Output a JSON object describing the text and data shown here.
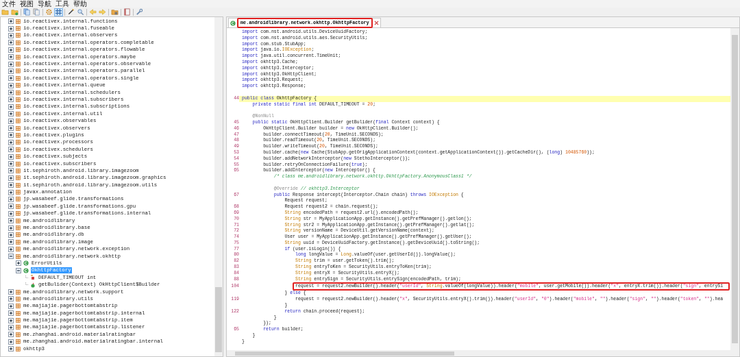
{
  "menu": [
    "文件",
    "视图",
    "导航",
    "工具",
    "帮助"
  ],
  "toolbar": [
    {
      "kind": "open",
      "pressed": false
    },
    {
      "kind": "add",
      "pressed": false
    },
    {
      "kind": "separator"
    },
    {
      "kind": "copy",
      "pressed": false
    },
    {
      "kind": "copy-gray",
      "pressed": false
    },
    {
      "kind": "separator"
    },
    {
      "kind": "gear",
      "pressed": false
    },
    {
      "kind": "grid",
      "pressed": true
    },
    {
      "kind": "separator"
    },
    {
      "kind": "pen",
      "pressed": false
    },
    {
      "kind": "search",
      "pressed": false
    },
    {
      "kind": "separator"
    },
    {
      "kind": "back",
      "pressed": false
    },
    {
      "kind": "forward",
      "pressed": false
    },
    {
      "kind": "separator"
    },
    {
      "kind": "lock",
      "pressed": false
    },
    {
      "kind": "separator"
    },
    {
      "kind": "book",
      "pressed": false
    },
    {
      "kind": "separator"
    },
    {
      "kind": "wrench",
      "pressed": false
    }
  ],
  "tree": {
    "items": [
      {
        "label": "io.reactivex.internal.functions",
        "kind": "package",
        "expanded": false,
        "selected": false
      },
      {
        "label": "io.reactivex.internal.fuseable",
        "kind": "package",
        "expanded": false,
        "selected": false
      },
      {
        "label": "io.reactivex.internal.observers",
        "kind": "package",
        "expanded": false,
        "selected": false
      },
      {
        "label": "io.reactivex.internal.operators.completable",
        "kind": "package",
        "expanded": false,
        "selected": false
      },
      {
        "label": "io.reactivex.internal.operators.flowable",
        "kind": "package",
        "expanded": false,
        "selected": false
      },
      {
        "label": "io.reactivex.internal.operators.maybe",
        "kind": "package",
        "expanded": false,
        "selected": false
      },
      {
        "label": "io.reactivex.internal.operators.observable",
        "kind": "package",
        "expanded": false,
        "selected": false
      },
      {
        "label": "io.reactivex.internal.operators.parallel",
        "kind": "package",
        "expanded": false,
        "selected": false
      },
      {
        "label": "io.reactivex.internal.operators.single",
        "kind": "package",
        "expanded": false,
        "selected": false
      },
      {
        "label": "io.reactivex.internal.queue",
        "kind": "package",
        "expanded": false,
        "selected": false
      },
      {
        "label": "io.reactivex.internal.schedulers",
        "kind": "package",
        "expanded": false,
        "selected": false
      },
      {
        "label": "io.reactivex.internal.subscribers",
        "kind": "package",
        "expanded": false,
        "selected": false
      },
      {
        "label": "io.reactivex.internal.subscriptions",
        "kind": "package",
        "expanded": false,
        "selected": false
      },
      {
        "label": "io.reactivex.internal.util",
        "kind": "package",
        "expanded": false,
        "selected": false
      },
      {
        "label": "io.reactivex.observables",
        "kind": "package",
        "expanded": false,
        "selected": false
      },
      {
        "label": "io.reactivex.observers",
        "kind": "package",
        "expanded": false,
        "selected": false
      },
      {
        "label": "io.reactivex.plugins",
        "kind": "package",
        "expanded": false,
        "selected": false
      },
      {
        "label": "io.reactivex.processors",
        "kind": "package",
        "expanded": false,
        "selected": false
      },
      {
        "label": "io.reactivex.schedulers",
        "kind": "package",
        "expanded": false,
        "selected": false
      },
      {
        "label": "io.reactivex.subjects",
        "kind": "package",
        "expanded": false,
        "selected": false
      },
      {
        "label": "io.reactivex.subscribers",
        "kind": "package",
        "expanded": false,
        "selected": false
      },
      {
        "label": "it.sephiroth.android.library.imagezoom",
        "kind": "package",
        "expanded": false,
        "selected": false
      },
      {
        "label": "it.sephiroth.android.library.imagezoom.graphics",
        "kind": "package",
        "expanded": false,
        "selected": false
      },
      {
        "label": "it.sephiroth.android.library.imagezoom.utils",
        "kind": "package",
        "expanded": false,
        "selected": false
      },
      {
        "label": "javax.annotation",
        "kind": "package",
        "expanded": false,
        "selected": false
      },
      {
        "label": "jp.wasabeef.glide.transformations",
        "kind": "package",
        "expanded": false,
        "selected": false
      },
      {
        "label": "jp.wasabeef.glide.transformations.gpu",
        "kind": "package",
        "expanded": false,
        "selected": false
      },
      {
        "label": "jp.wasabeef.glide.transformations.internal",
        "kind": "package",
        "expanded": false,
        "selected": false
      },
      {
        "label": "me.androidlibrary",
        "kind": "package",
        "expanded": false,
        "selected": false
      },
      {
        "label": "me.androidlibrary.base",
        "kind": "package",
        "expanded": false,
        "selected": false
      },
      {
        "label": "me.androidlibrary.db",
        "kind": "package",
        "expanded": false,
        "selected": false
      },
      {
        "label": "me.androidlibrary.image",
        "kind": "package",
        "expanded": false,
        "selected": false
      },
      {
        "label": "me.androidlibrary.network.exception",
        "kind": "package",
        "expanded": false,
        "selected": false
      },
      {
        "label": "me.androidlibrary.network.okhttp",
        "kind": "package",
        "expanded": true,
        "selected": false,
        "children": [
          {
            "label": "ErrorUtils",
            "kind": "class",
            "expanded": false,
            "selected": false
          },
          {
            "label": "OkhttpFactory",
            "kind": "class",
            "expanded": true,
            "selected": true,
            "children": [
              {
                "label": "DEFAULT_TIMEOUT int",
                "kind": "field",
                "selected": false
              },
              {
                "label": "getBulider(Context) OkHttpClient$Builder",
                "kind": "method",
                "selected": false
              }
            ]
          }
        ]
      },
      {
        "label": "me.androidlibrary.network.support",
        "kind": "package",
        "expanded": false,
        "selected": false
      },
      {
        "label": "me.androidlibrary.utils",
        "kind": "package",
        "expanded": false,
        "selected": false
      },
      {
        "label": "me.majiajie.pagerbottomtabstrip",
        "kind": "package",
        "expanded": false,
        "selected": false
      },
      {
        "label": "me.majiajie.pagerbottomtabstrip.internal",
        "kind": "package",
        "expanded": false,
        "selected": false
      },
      {
        "label": "me.majiajie.pagerbottomtabstrip.item",
        "kind": "package",
        "expanded": false,
        "selected": false
      },
      {
        "label": "me.majiajie.pagerbottomtabstrip.listener",
        "kind": "package",
        "expanded": false,
        "selected": false
      },
      {
        "label": "me.zhanghai.android.materialratingbar",
        "kind": "package",
        "expanded": false,
        "selected": false
      },
      {
        "label": "me.zhanghai.android.materialratingbar.internal",
        "kind": "package",
        "expanded": false,
        "selected": false
      },
      {
        "label": "okhttp3",
        "kind": "package",
        "expanded": false,
        "selected": false
      }
    ]
  },
  "tabs": [
    {
      "title": "me.androidlibrary.network.okhttp.OkhttpFactory",
      "selected": true,
      "boxed": true
    }
  ],
  "code": {
    "lines": [
      {
        "kind": "code",
        "highlighted": false,
        "boxed": false,
        "segments": [
          {
            "kind": "keyword",
            "text": "import"
          },
          {
            "kind": "plain",
            "text": " com.nst.android.utils.DeviceUuidFactory;"
          }
        ]
      },
      {
        "kind": "code",
        "highlighted": false,
        "boxed": false,
        "segments": [
          {
            "kind": "keyword",
            "text": "import"
          },
          {
            "kind": "plain",
            "text": " com.nst.android.utils.aes.SecurityUtils;"
          }
        ]
      },
      {
        "kind": "code",
        "highlighted": false,
        "boxed": false,
        "segments": [
          {
            "kind": "keyword",
            "text": "import"
          },
          {
            "kind": "plain",
            "text": " com.stub.StubApp;"
          }
        ]
      },
      {
        "kind": "code",
        "highlighted": false,
        "boxed": false,
        "segments": [
          {
            "kind": "keyword",
            "text": "import"
          },
          {
            "kind": "plain",
            "text": " java.io."
          },
          {
            "kind": "type",
            "text": "IOException"
          },
          {
            "kind": "plain",
            "text": ";"
          }
        ]
      },
      {
        "kind": "code",
        "highlighted": false,
        "boxed": false,
        "segments": [
          {
            "kind": "keyword",
            "text": "import"
          },
          {
            "kind": "plain",
            "text": " java.util.concurrent.TimeUnit;"
          }
        ]
      },
      {
        "kind": "code",
        "highlighted": false,
        "boxed": false,
        "segments": [
          {
            "kind": "keyword",
            "text": "import"
          },
          {
            "kind": "plain",
            "text": " okhttp3.Cache;"
          }
        ]
      },
      {
        "kind": "code",
        "highlighted": false,
        "boxed": false,
        "segments": [
          {
            "kind": "keyword",
            "text": "import"
          },
          {
            "kind": "plain",
            "text": " okhttp3.Interceptor;"
          }
        ]
      },
      {
        "kind": "code",
        "highlighted": false,
        "boxed": false,
        "segments": [
          {
            "kind": "keyword",
            "text": "import"
          },
          {
            "kind": "plain",
            "text": " okhttp3.OkHttpClient;"
          }
        ]
      },
      {
        "kind": "code",
        "highlighted": false,
        "boxed": false,
        "segments": [
          {
            "kind": "keyword",
            "text": "import"
          },
          {
            "kind": "plain",
            "text": " okhttp3.Request;"
          }
        ]
      },
      {
        "kind": "code",
        "highlighted": false,
        "boxed": false,
        "segments": [
          {
            "kind": "keyword",
            "text": "import"
          },
          {
            "kind": "plain",
            "text": " okhttp3.Response;"
          }
        ]
      },
      {
        "kind": "blank",
        "highlighted": false,
        "boxed": false
      },
      {
        "kind": "code",
        "number": "44",
        "highlighted": true,
        "boxed": false,
        "segments": [
          {
            "kind": "keyword",
            "text": "public class"
          },
          {
            "kind": "plain",
            "text": " OkhttpFactory {"
          }
        ],
        "children": [
          {
            "kind": "code",
            "highlighted": false,
            "boxed": false,
            "segments": [
              {
                "kind": "keyword",
                "text": "private static final int"
              },
              {
                "kind": "plain",
                "text": " DEFAULT_TIMEOUT = "
              },
              {
                "kind": "number",
                "text": "20"
              },
              {
                "kind": "plain",
                "text": ";"
              }
            ]
          },
          {
            "kind": "blank",
            "highlighted": false,
            "boxed": false
          },
          {
            "kind": "code",
            "highlighted": false,
            "boxed": false,
            "segments": [
              {
                "kind": "annotation",
                "text": "@NonNull"
              }
            ]
          },
          {
            "kind": "code",
            "number": "45",
            "highlighted": false,
            "boxed": false,
            "segments": [
              {
                "kind": "keyword",
                "text": "public static"
              },
              {
                "kind": "plain",
                "text": " OkHttpClient.Builder getBulider("
              },
              {
                "kind": "keyword",
                "text": "final"
              },
              {
                "kind": "plain",
                "text": " Context context) {"
              }
            ],
            "children": [
              {
                "kind": "code",
                "number": "46",
                "highlighted": false,
                "boxed": false,
                "segments": [
                  {
                    "kind": "plain",
                    "text": "OkHttpClient.Builder builder = "
                  },
                  {
                    "kind": "keyword",
                    "text": "new"
                  },
                  {
                    "kind": "plain",
                    "text": " OkHttpClient.Builder();"
                  }
                ]
              },
              {
                "kind": "code",
                "number": "47",
                "highlighted": false,
                "boxed": false,
                "segments": [
                  {
                    "kind": "plain",
                    "text": "builder.connectTimeout("
                  },
                  {
                    "kind": "number",
                    "text": "20"
                  },
                  {
                    "kind": "plain",
                    "text": ", TimeUnit.SECONDS);"
                  }
                ]
              },
              {
                "kind": "code",
                "number": "48",
                "highlighted": false,
                "boxed": false,
                "segments": [
                  {
                    "kind": "plain",
                    "text": "builder.readTimeout("
                  },
                  {
                    "kind": "number",
                    "text": "20"
                  },
                  {
                    "kind": "plain",
                    "text": ", TimeUnit.SECONDS);"
                  }
                ]
              },
              {
                "kind": "code",
                "number": "49",
                "highlighted": false,
                "boxed": false,
                "segments": [
                  {
                    "kind": "plain",
                    "text": "builder.writeTimeout("
                  },
                  {
                    "kind": "number",
                    "text": "20"
                  },
                  {
                    "kind": "plain",
                    "text": ", TimeUnit.SECONDS);"
                  }
                ]
              },
              {
                "kind": "code",
                "number": "53",
                "highlighted": false,
                "boxed": false,
                "segments": [
                  {
                    "kind": "plain",
                    "text": "builder.cache("
                  },
                  {
                    "kind": "keyword",
                    "text": "new"
                  },
                  {
                    "kind": "plain",
                    "text": " Cache(StubApp.getOrigApplicationContext(context.getApplicationContext()).getCacheDir(), ("
                  },
                  {
                    "kind": "keyword",
                    "text": "long"
                  },
                  {
                    "kind": "plain",
                    "text": ") "
                  },
                  {
                    "kind": "number",
                    "text": "10485760"
                  },
                  {
                    "kind": "plain",
                    "text": "));"
                  }
                ]
              },
              {
                "kind": "code",
                "number": "54",
                "highlighted": false,
                "boxed": false,
                "segments": [
                  {
                    "kind": "plain",
                    "text": "builder.addNetworkInterceptor("
                  },
                  {
                    "kind": "keyword",
                    "text": "new"
                  },
                  {
                    "kind": "plain",
                    "text": " StethoInterceptor());"
                  }
                ]
              },
              {
                "kind": "code",
                "number": "55",
                "highlighted": false,
                "boxed": false,
                "segments": [
                  {
                    "kind": "plain",
                    "text": "builder.retryOnConnectionFailure("
                  },
                  {
                    "kind": "keyword",
                    "text": "true"
                  },
                  {
                    "kind": "plain",
                    "text": ");"
                  }
                ]
              },
              {
                "kind": "code",
                "number": "65",
                "highlighted": false,
                "boxed": false,
                "segments": [
                  {
                    "kind": "plain",
                    "text": "builder.addInterceptor("
                  },
                  {
                    "kind": "keyword",
                    "text": "new"
                  },
                  {
                    "kind": "plain",
                    "text": " Interceptor() {"
                  }
                ],
                "children": [
                  {
                    "kind": "code",
                    "highlighted": false,
                    "boxed": false,
                    "segments": [
                      {
                        "kind": "comment",
                        "text": "/* class me.androidlibrary.network.okhttp.OkhttpFactory.AnonymousClass1 */"
                      }
                    ]
                  },
                  {
                    "kind": "blank",
                    "highlighted": false,
                    "boxed": false
                  },
                  {
                    "kind": "code",
                    "highlighted": false,
                    "boxed": false,
                    "segments": [
                      {
                        "kind": "annotation",
                        "text": "@Override"
                      },
                      {
                        "kind": "comment",
                        "text": " // okhttp3.Interceptor"
                      }
                    ]
                  },
                  {
                    "kind": "code",
                    "number": "67",
                    "highlighted": false,
                    "boxed": false,
                    "segments": [
                      {
                        "kind": "keyword",
                        "text": "public"
                      },
                      {
                        "kind": "plain",
                        "text": " Response intercept(Interceptor.Chain chain) "
                      },
                      {
                        "kind": "keyword",
                        "text": "throws"
                      },
                      {
                        "kind": "type",
                        "text": " IOException"
                      },
                      {
                        "kind": "plain",
                        "text": " {"
                      }
                    ],
                    "children": [
                      {
                        "kind": "code",
                        "highlighted": false,
                        "boxed": false,
                        "segments": [
                          {
                            "kind": "plain",
                            "text": "Request request;"
                          }
                        ]
                      },
                      {
                        "kind": "code",
                        "number": "68",
                        "highlighted": false,
                        "boxed": false,
                        "segments": [
                          {
                            "kind": "plain",
                            "text": "Request request2 = chain.request();"
                          }
                        ]
                      },
                      {
                        "kind": "code",
                        "number": "69",
                        "highlighted": false,
                        "boxed": false,
                        "segments": [
                          {
                            "kind": "type",
                            "text": "String"
                          },
                          {
                            "kind": "plain",
                            "text": " encodedPath = request2.url().encodedPath();"
                          }
                        ]
                      },
                      {
                        "kind": "code",
                        "number": "70",
                        "highlighted": false,
                        "boxed": false,
                        "segments": [
                          {
                            "kind": "type",
                            "text": "String"
                          },
                          {
                            "kind": "plain",
                            "text": " str = MyApplicationApp.getInstance().getPrefManager().getlon();"
                          }
                        ]
                      },
                      {
                        "kind": "code",
                        "number": "71",
                        "highlighted": false,
                        "boxed": false,
                        "segments": [
                          {
                            "kind": "type",
                            "text": "String"
                          },
                          {
                            "kind": "plain",
                            "text": " str2 = MyApplicationApp.getInstance().getPrefManager().getlat();"
                          }
                        ]
                      },
                      {
                        "kind": "code",
                        "number": "72",
                        "highlighted": false,
                        "boxed": false,
                        "segments": [
                          {
                            "kind": "type",
                            "text": "String"
                          },
                          {
                            "kind": "plain",
                            "text": " versionName = DeviceUtil.getVersionName(context);"
                          }
                        ]
                      },
                      {
                        "kind": "code",
                        "number": "74",
                        "highlighted": false,
                        "boxed": false,
                        "segments": [
                          {
                            "kind": "plain",
                            "text": "User user = MyApplicationApp.getInstance().getPrefManager().getUser();"
                          }
                        ]
                      },
                      {
                        "kind": "code",
                        "number": "75",
                        "highlighted": false,
                        "boxed": false,
                        "segments": [
                          {
                            "kind": "type",
                            "text": "String"
                          },
                          {
                            "kind": "plain",
                            "text": " uuid = DeviceUuidFactory.getInstance().getDeviceUuid().toString();"
                          }
                        ]
                      },
                      {
                        "kind": "code",
                        "number": "77",
                        "highlighted": false,
                        "boxed": false,
                        "segments": [
                          {
                            "kind": "keyword",
                            "text": "if"
                          },
                          {
                            "kind": "plain",
                            "text": " (user.isLogin()) {"
                          }
                        ],
                        "children": [
                          {
                            "kind": "code",
                            "number": "80",
                            "highlighted": false,
                            "boxed": false,
                            "segments": [
                              {
                                "kind": "keyword",
                                "text": "long"
                              },
                              {
                                "kind": "plain",
                                "text": " longValue = "
                              },
                              {
                                "kind": "type",
                                "text": "Long"
                              },
                              {
                                "kind": "plain",
                                "text": ".valueOf(user.getUserId()).longValue();"
                              }
                            ]
                          },
                          {
                            "kind": "code",
                            "number": "82",
                            "highlighted": false,
                            "boxed": false,
                            "segments": [
                              {
                                "kind": "type",
                                "text": "String"
                              },
                              {
                                "kind": "plain",
                                "text": " trim = user.getToken().trim();"
                              }
                            ]
                          },
                          {
                            "kind": "code",
                            "number": "83",
                            "highlighted": false,
                            "boxed": false,
                            "segments": [
                              {
                                "kind": "type",
                                "text": "String"
                              },
                              {
                                "kind": "plain",
                                "text": " entryToKen = SecurityUtils.entryToKen(trim);"
                              }
                            ]
                          },
                          {
                            "kind": "code",
                            "number": "84",
                            "highlighted": false,
                            "boxed": false,
                            "segments": [
                              {
                                "kind": "type",
                                "text": "String"
                              },
                              {
                                "kind": "plain",
                                "text": " entryX = SecurityUtils.entryX();"
                              }
                            ]
                          },
                          {
                            "kind": "code",
                            "number": "88",
                            "highlighted": false,
                            "boxed": false,
                            "segments": [
                              {
                                "kind": "type",
                                "text": "String"
                              },
                              {
                                "kind": "plain",
                                "text": " entrySign = SecurityUtils.entrySign(encodedPath, trim);"
                              }
                            ]
                          },
                          {
                            "kind": "code",
                            "number": "104",
                            "highlighted": false,
                            "boxed": true,
                            "segments": [
                              {
                                "kind": "plain",
                                "text": "request = request2.newBuilder().header("
                              },
                              {
                                "kind": "string",
                                "text": "\"userId\""
                              },
                              {
                                "kind": "plain",
                                "text": ", "
                              },
                              {
                                "kind": "type",
                                "text": "String"
                              },
                              {
                                "kind": "plain",
                                "text": ".valueOf(longValue)).header("
                              },
                              {
                                "kind": "string",
                                "text": "\"mobile\""
                              },
                              {
                                "kind": "plain",
                                "text": ", user.getMobile()).header("
                              },
                              {
                                "kind": "string",
                                "text": "\"x\""
                              },
                              {
                                "kind": "plain",
                                "text": ", entryX.trim()).header("
                              },
                              {
                                "kind": "string",
                                "text": "\"sign\""
                              },
                              {
                                "kind": "plain",
                                "text": ", entrySi"
                              }
                            ]
                          }
                        ]
                      },
                      {
                        "kind": "code",
                        "highlighted": false,
                        "boxed": false,
                        "segments": [
                          {
                            "kind": "plain",
                            "text": "} "
                          },
                          {
                            "kind": "keyword",
                            "text": "else"
                          },
                          {
                            "kind": "plain",
                            "text": " {"
                          }
                        ],
                        "children": [
                          {
                            "kind": "code",
                            "number": "119",
                            "highlighted": false,
                            "boxed": false,
                            "segments": [
                              {
                                "kind": "plain",
                                "text": "request = request2.newBuilder().header("
                              },
                              {
                                "kind": "string",
                                "text": "\"x\""
                              },
                              {
                                "kind": "plain",
                                "text": ", SecurityUtils.entryX().trim()).header("
                              },
                              {
                                "kind": "string",
                                "text": "\"userId\""
                              },
                              {
                                "kind": "plain",
                                "text": ", "
                              },
                              {
                                "kind": "string",
                                "text": "\"0\""
                              },
                              {
                                "kind": "plain",
                                "text": ").header("
                              },
                              {
                                "kind": "string",
                                "text": "\"mobile\""
                              },
                              {
                                "kind": "plain",
                                "text": ", "
                              },
                              {
                                "kind": "string",
                                "text": "\"\""
                              },
                              {
                                "kind": "plain",
                                "text": ").header("
                              },
                              {
                                "kind": "string",
                                "text": "\"sign\""
                              },
                              {
                                "kind": "plain",
                                "text": ", "
                              },
                              {
                                "kind": "string",
                                "text": "\"\""
                              },
                              {
                                "kind": "plain",
                                "text": ").header("
                              },
                              {
                                "kind": "string",
                                "text": "\"token\""
                              },
                              {
                                "kind": "plain",
                                "text": ", "
                              },
                              {
                                "kind": "string",
                                "text": "\"\""
                              },
                              {
                                "kind": "plain",
                                "text": ").hea"
                              }
                            ]
                          }
                        ]
                      },
                      {
                        "kind": "code",
                        "highlighted": false,
                        "boxed": false,
                        "segments": [
                          {
                            "kind": "plain",
                            "text": "}"
                          }
                        ]
                      },
                      {
                        "kind": "code",
                        "number": "122",
                        "highlighted": false,
                        "boxed": false,
                        "segments": [
                          {
                            "kind": "keyword",
                            "text": "return"
                          },
                          {
                            "kind": "plain",
                            "text": " chain.proceed(request);"
                          }
                        ]
                      }
                    ]
                  },
                  {
                    "kind": "code",
                    "highlighted": false,
                    "boxed": false,
                    "segments": [
                      {
                        "kind": "plain",
                        "text": "}"
                      }
                    ]
                  }
                ]
              },
              {
                "kind": "code",
                "highlighted": false,
                "boxed": false,
                "segments": [
                  {
                    "kind": "plain",
                    "text": "});"
                  }
                ]
              },
              {
                "kind": "code",
                "number": "65",
                "highlighted": false,
                "boxed": false,
                "segments": [
                  {
                    "kind": "keyword",
                    "text": "return"
                  },
                  {
                    "kind": "plain",
                    "text": " builder;"
                  }
                ]
              }
            ]
          },
          {
            "kind": "code",
            "highlighted": false,
            "boxed": false,
            "segments": [
              {
                "kind": "plain",
                "text": "}"
              }
            ]
          }
        ]
      },
      {
        "kind": "code",
        "highlighted": false,
        "boxed": false,
        "segments": [
          {
            "kind": "plain",
            "text": "}"
          }
        ]
      }
    ]
  }
}
